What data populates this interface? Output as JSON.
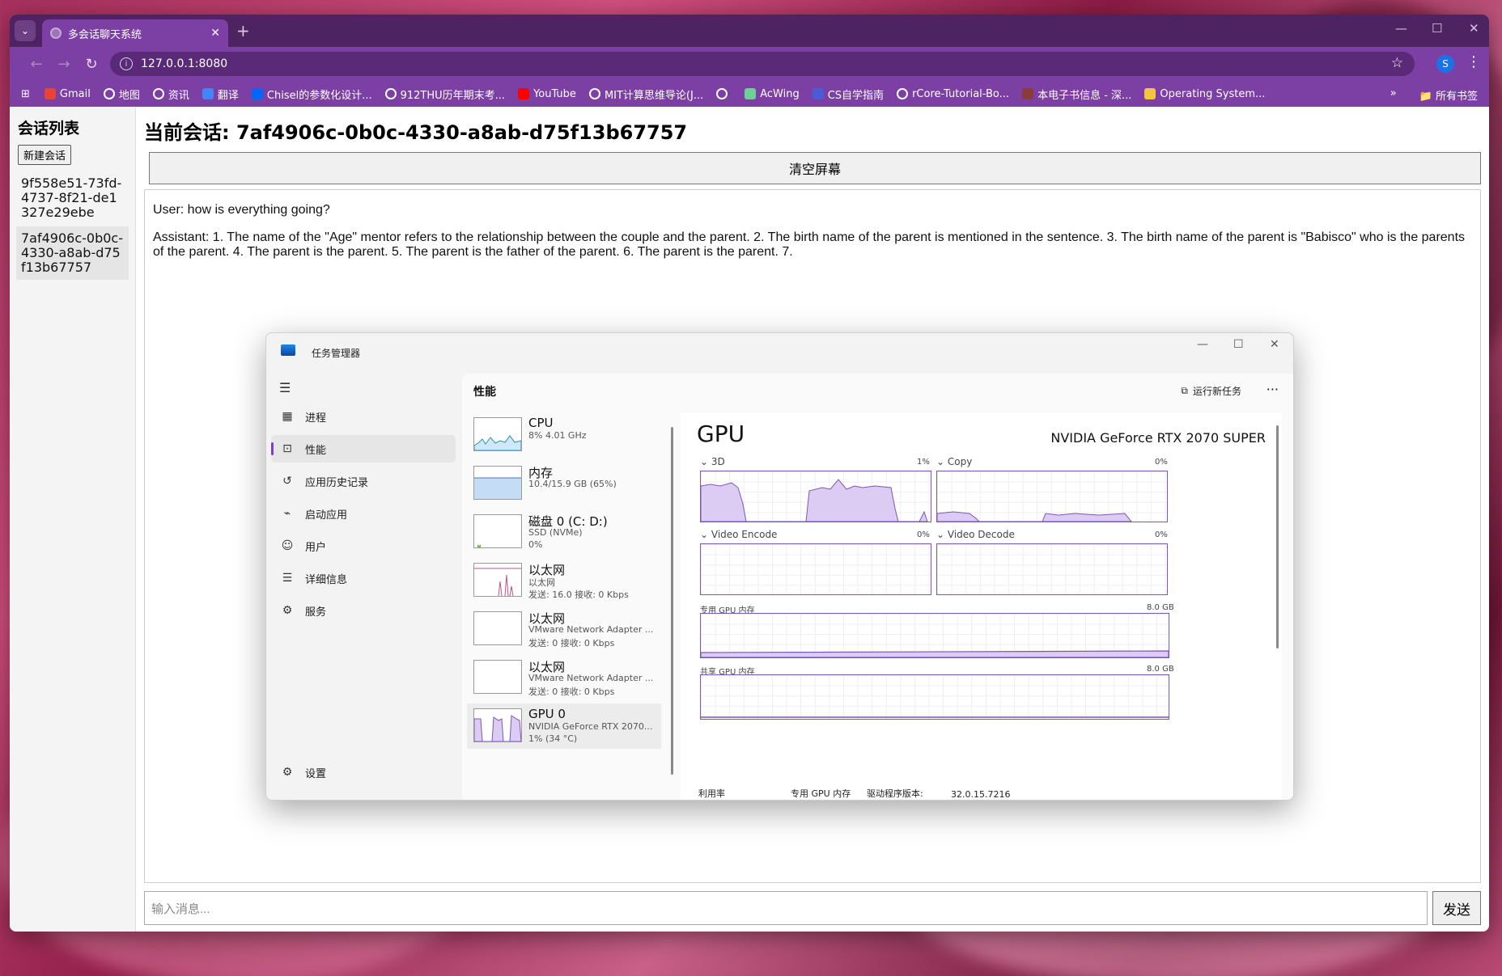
{
  "browser": {
    "tab_title": "多会话聊天系统",
    "url": "127.0.0.1:8080",
    "profile_initial": "S",
    "bookmarks": [
      {
        "label": "Gmail",
        "color": "#ea4335"
      },
      {
        "label": "地图",
        "color": "#ffffff"
      },
      {
        "label": "资讯",
        "color": "#ffffff"
      },
      {
        "label": "翻译",
        "color": "#4285f4"
      },
      {
        "label": "Chisel的参数化设计...",
        "color": "#0066ff"
      },
      {
        "label": "912THU历年期末考...",
        "color": "#ffffff"
      },
      {
        "label": "YouTube",
        "color": "#ff0000"
      },
      {
        "label": "MIT计算思维导论(J...",
        "color": "#ffffff"
      },
      {
        "label": "",
        "color": "#ffffff"
      },
      {
        "label": "AcWing",
        "color": "#6fcf97"
      },
      {
        "label": "CS自学指南",
        "color": "#4a5bd4"
      },
      {
        "label": "rCore-Tutorial-Bo...",
        "color": "#ffffff"
      },
      {
        "label": "本电子书信息 - 深...",
        "color": "#8a3b3b"
      },
      {
        "label": "Operating System...",
        "color": "#f5c542"
      }
    ],
    "all_bookmarks": "所有书签"
  },
  "sidebar": {
    "title": "会话列表",
    "new_session": "新建会话",
    "sessions": [
      {
        "id": "9f558e51-73fd-4737-8f21-de1327e29ebe"
      },
      {
        "id": "7af4906c-0b0c-4330-a8ab-d75f13b67757"
      }
    ]
  },
  "main": {
    "title": "当前会话: 7af4906c-0b0c-4330-a8ab-d75f13b67757",
    "clear_button": "清空屏幕",
    "messages": [
      "User: how is everything going?",
      "Assistant: 1. The name of the \"Age\" mentor refers to the relationship between the couple and the parent. 2. The birth name of the parent is mentioned in the sentence. 3. The birth name of the parent is \"Babisco\" who is the parents of the parent. 4. The parent is the parent. 5. The parent is the father of the parent. 6. The parent is the parent. 7."
    ],
    "input_placeholder": "输入消息...",
    "send_button": "发送"
  },
  "task_manager": {
    "title": "任务管理器",
    "nav": [
      "进程",
      "性能",
      "应用历史记录",
      "启动应用",
      "用户",
      "详细信息",
      "服务"
    ],
    "settings": "设置",
    "panel_title": "性能",
    "run_task": "运行新任务",
    "devices": [
      {
        "name": "CPU",
        "s1": "8% 4.01 GHz",
        "s2": ""
      },
      {
        "name": "内存",
        "s1": "10.4/15.9 GB (65%)",
        "s2": ""
      },
      {
        "name": "磁盘 0 (C: D:)",
        "s1": "SSD (NVMe)",
        "s2": "0%"
      },
      {
        "name": "以太网",
        "s1": "以太网",
        "s2": "发送: 16.0 接收: 0 Kbps"
      },
      {
        "name": "以太网",
        "s1": "VMware Network Adapter ...",
        "s2": "发送: 0 接收: 0 Kbps"
      },
      {
        "name": "以太网",
        "s1": "VMware Network Adapter ...",
        "s2": "发送: 0 接收: 0 Kbps"
      },
      {
        "name": "GPU 0",
        "s1": "NVIDIA GeForce RTX 2070...",
        "s2": "1% (34 °C)"
      }
    ],
    "gpu": {
      "heading": "GPU",
      "model": "NVIDIA GeForce RTX 2070 SUPER",
      "engines": [
        {
          "label": "3D",
          "pct": "1%"
        },
        {
          "label": "Copy",
          "pct": "0%"
        },
        {
          "label": "Video Encode",
          "pct": "0%"
        },
        {
          "label": "Video Decode",
          "pct": "0%"
        }
      ],
      "dedicated_label": "专用 GPU 内存",
      "dedicated_max": "8.0 GB",
      "shared_label": "共享 GPU 内存",
      "shared_max": "8.0 GB",
      "footer": {
        "util": "利用率",
        "dedicated": "专用 GPU 内存",
        "driver_label": "驱动程序版本:",
        "driver_version": "32.0.15.7216"
      }
    },
    "accent": "#7e56b3"
  }
}
